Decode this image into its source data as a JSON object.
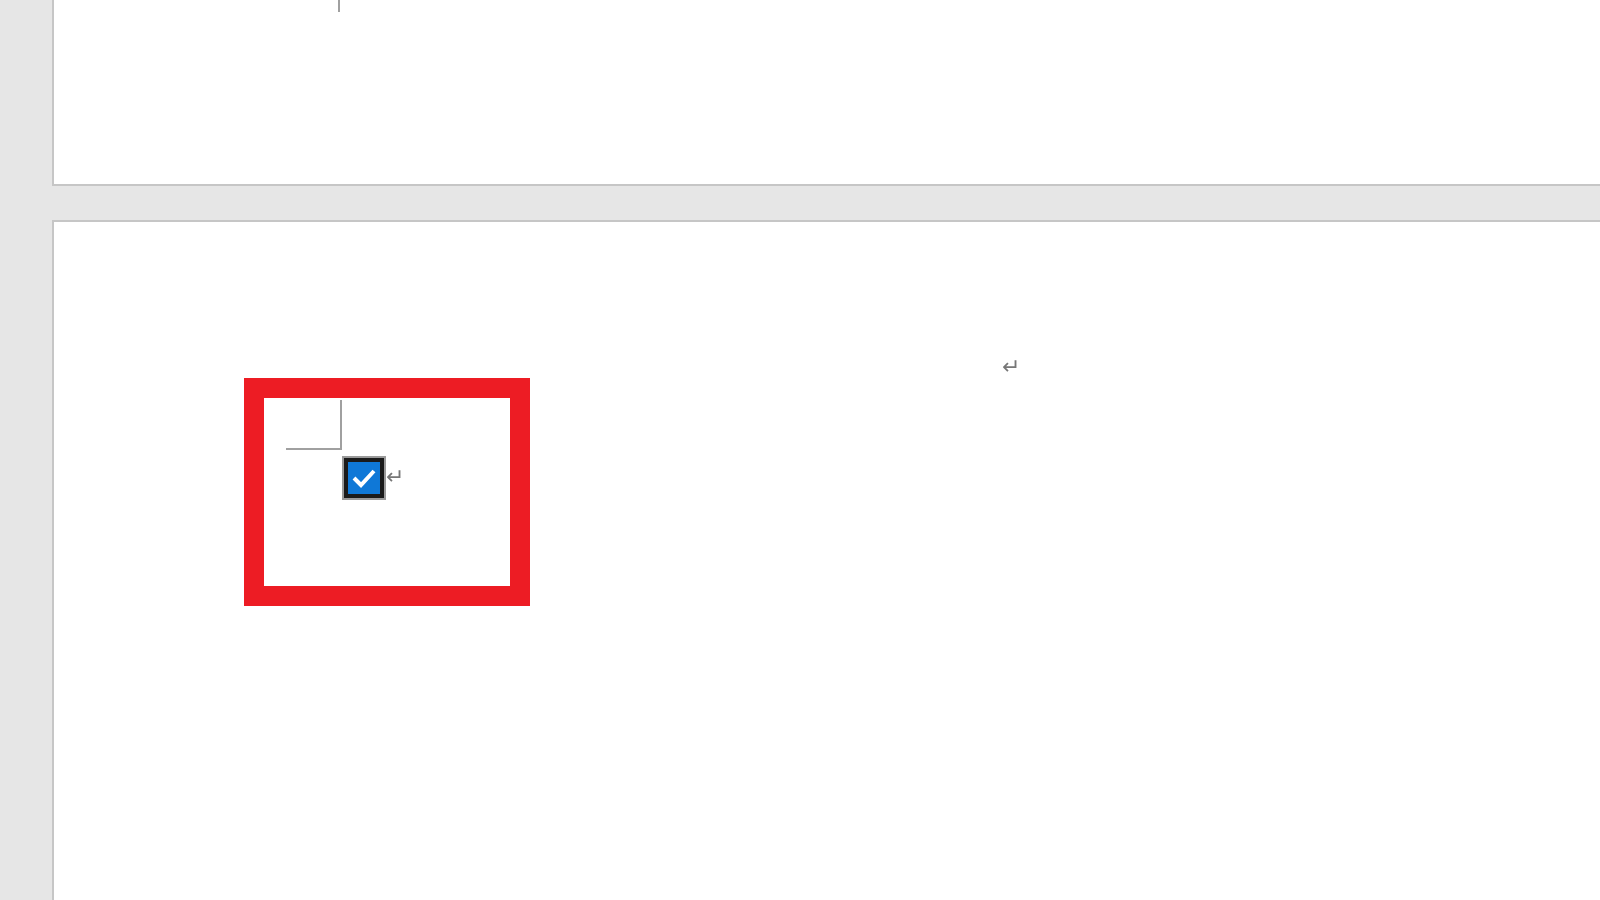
{
  "document": {
    "pages": [
      {
        "kind": "previous"
      },
      {
        "kind": "current",
        "paragraphs": [
          {
            "mark": "↵"
          },
          {
            "checkbox": {
              "checked": true
            },
            "mark": "↵"
          }
        ]
      }
    ]
  },
  "annotation": {
    "kind": "highlight-frame"
  }
}
